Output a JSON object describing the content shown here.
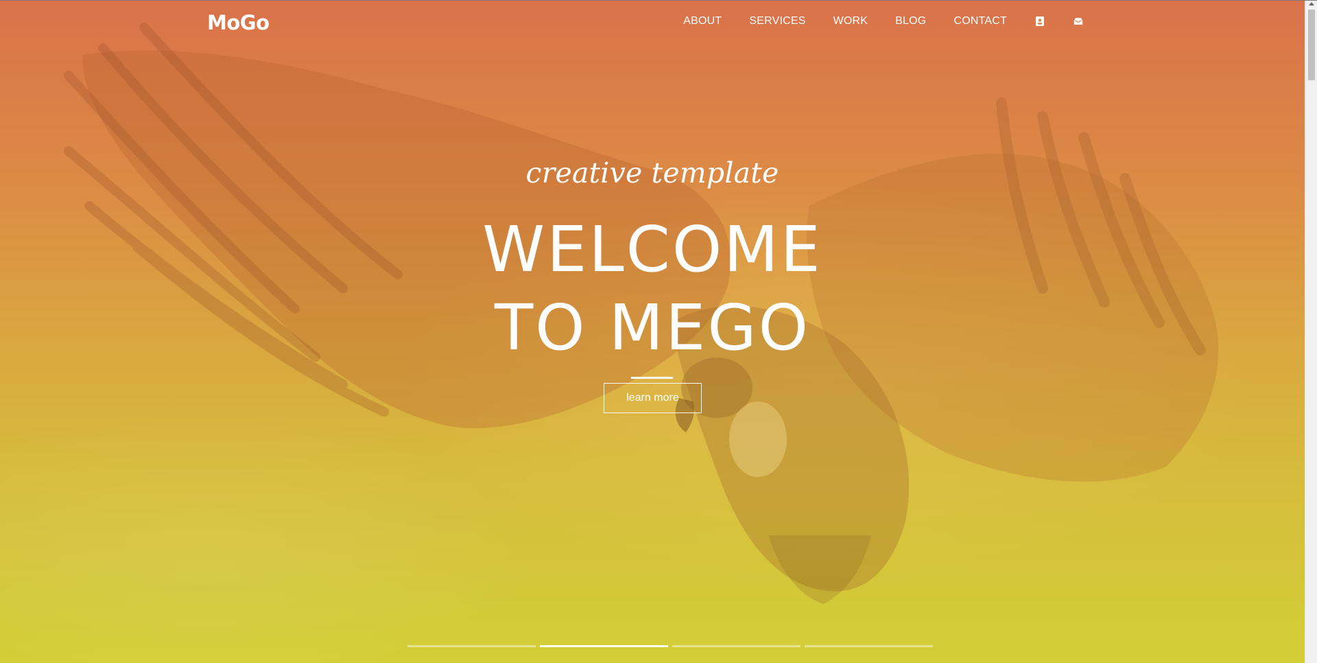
{
  "header": {
    "logo": "MoGo",
    "nav": [
      {
        "label": "ABOUT"
      },
      {
        "label": "SERVICES"
      },
      {
        "label": "WORK"
      },
      {
        "label": "BLOG"
      },
      {
        "label": "CONTACT"
      }
    ],
    "icons": [
      "contact-card-icon",
      "inbox-icon"
    ]
  },
  "hero": {
    "subtitle": "creative template",
    "title_line_1": "WELCOME",
    "title_line_2": "TO MEGO",
    "button_label": "learn more",
    "slides": {
      "count": 4,
      "active_index": 1
    }
  },
  "colors": {
    "gradient_top": "#d9724a",
    "gradient_bottom": "#d3cf37",
    "text": "#ffffff"
  }
}
